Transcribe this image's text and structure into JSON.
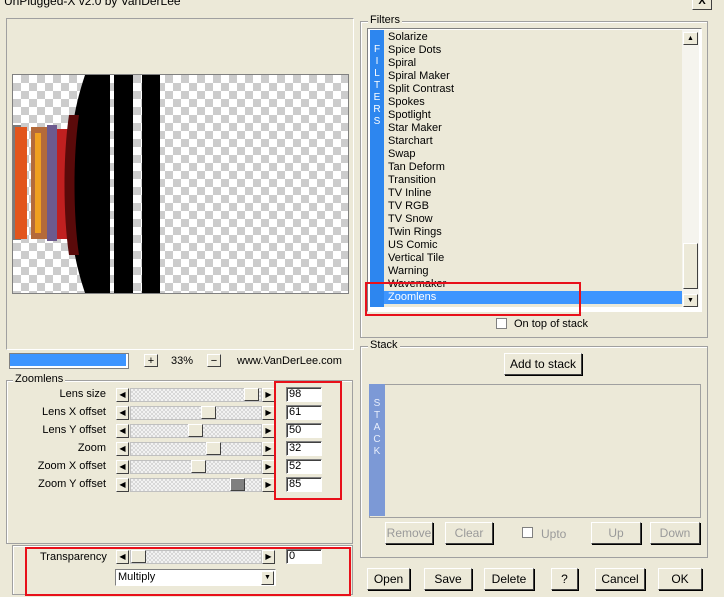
{
  "window": {
    "title": "UnPlugged-X v2.0 by VanDerLee",
    "close_glyph": "X"
  },
  "preview": {
    "zoom_plus": "+",
    "zoom_value": "33%",
    "zoom_minus": "−",
    "website": "www.VanDerLee.com",
    "progress": 1.0
  },
  "zoomlens": {
    "group_label": "Zoomlens",
    "sliders": [
      {
        "label": "Lens size",
        "value": "98"
      },
      {
        "label": "Lens X offset",
        "value": "61"
      },
      {
        "label": "Lens Y offset",
        "value": "50"
      },
      {
        "label": "Zoom",
        "value": "32"
      },
      {
        "label": "Zoom X offset",
        "value": "52"
      },
      {
        "label": "Zoom Y offset",
        "value": "85"
      }
    ]
  },
  "transparency": {
    "label": "Transparency",
    "value": "0",
    "blend_mode": "Multiply"
  },
  "filters": {
    "group_label": "Filters",
    "side_label": [
      "F",
      "I",
      "L",
      "T",
      "E",
      "R",
      "S"
    ],
    "items": [
      "Solarize",
      "Spice Dots",
      "Spiral",
      "Spiral Maker",
      "Split Contrast",
      "Spokes",
      "Spotlight",
      "Star Maker",
      "Starchart",
      "Swap",
      "Tan Deform",
      "Transition",
      "TV Inline",
      "TV RGB",
      "TV Snow",
      "Twin Rings",
      "US Comic",
      "Vertical Tile",
      "Warning",
      "Wavemaker",
      "Zoomlens"
    ],
    "selected": "Zoomlens",
    "on_top_label": "On top of stack"
  },
  "stack": {
    "group_label": "Stack",
    "add_label": "Add to stack",
    "side_label": [
      "S",
      "T",
      "A",
      "C",
      "K"
    ],
    "remove_label": "Remove",
    "clear_label": "Clear",
    "upto_label": "Upto",
    "up_label": "Up",
    "down_label": "Down"
  },
  "bottom_buttons": {
    "open": "Open",
    "save": "Save",
    "delete": "Delete",
    "help": "?",
    "cancel": "Cancel",
    "ok": "OK"
  },
  "colors": {
    "highlight": "#3d95ff",
    "annotation_red": "#e8101a",
    "stack_strip": "#7c99d6"
  }
}
